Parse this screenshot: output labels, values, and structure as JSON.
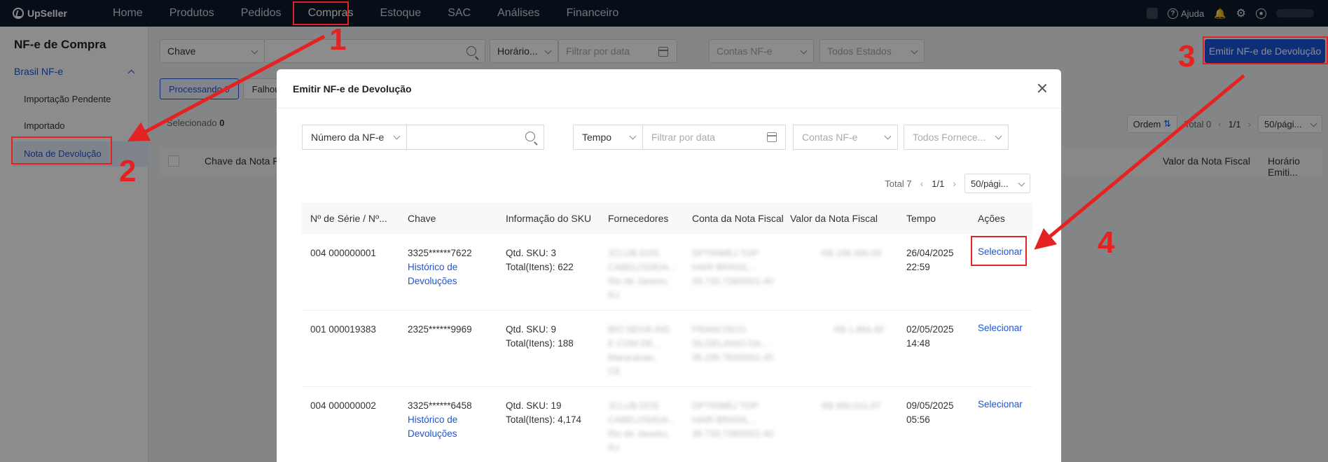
{
  "app": {
    "logo": "UpSeller",
    "nav": [
      "Home",
      "Produtos",
      "Pedidos",
      "Compras",
      "Estoque",
      "SAC",
      "Análises",
      "Financeiro"
    ],
    "active_nav": "Compras",
    "help": "Ajuda"
  },
  "sidebar": {
    "title": "NF-e de Compra",
    "group": "Brasil NF-e",
    "items": [
      "Importação Pendente",
      "Importado",
      "Nota de Devolução"
    ],
    "active": "Nota de Devolução"
  },
  "background": {
    "filters": {
      "key_select": "Chave",
      "time_select": "Horário...",
      "date_placeholder": "Filtrar por data",
      "accounts": "Contas NF-e",
      "states": "Todos Estados"
    },
    "emit_button": "Emitir NF-e de Devolução",
    "tabs": [
      "Processando 0",
      "Falhou"
    ],
    "selected_label": "Selecionado",
    "selected_count": "0",
    "order_button": "Ordem",
    "total": "Total 0",
    "page": "1/1",
    "per_page": "50/pági...",
    "columns": [
      "Chave da Nota Fiscal",
      "Valor da Nota Fiscal",
      "Horário Emiti..."
    ]
  },
  "modal": {
    "title": "Emitir NF-e de Devolução",
    "filters": {
      "nf_select": "Número da NF-e",
      "time_select": "Tempo",
      "date_placeholder": "Filtrar por data",
      "accounts": "Contas NF-e",
      "suppliers": "Todos Fornece..."
    },
    "total": "Total 7",
    "page": "1/1",
    "per_page": "50/pági...",
    "columns": [
      "Nº de Série / Nº...",
      "Chave",
      "Informação do SKU",
      "Fornecedores",
      "Conta da Nota Fiscal",
      "Valor da Nota Fiscal",
      "Tempo",
      "Ações"
    ],
    "rows": [
      {
        "serie": "004 000000001",
        "chave": "3325******7622",
        "history": [
          "Histórico de",
          "Devoluções"
        ],
        "sku_qtd": "Qtd. SKU: 3",
        "sku_total": "Total(Itens): 622",
        "supplier": [
          "JCLUB DOS",
          "CABELOS/EIA...",
          "Rio de Janeiro,",
          "RJ"
        ],
        "account": [
          "DPTRIMEJ TOP",
          "HAIR BRASIL...",
          "39.733.728/0001-40"
        ],
        "value": "R$ 168.490,00",
        "date": "26/04/2025",
        "time": "22:59",
        "action": "Selecionar"
      },
      {
        "serie": "001 000019383",
        "chave": "2325******9969",
        "history": [],
        "sku_qtd": "Qtd. SKU: 9",
        "sku_total": "Total(Itens): 188",
        "supplier": [
          "BIO SEIVA IND",
          "E COM DE...",
          "Maracanau,",
          "CE"
        ],
        "account": [
          "FRANCISCO",
          "SILDELANIO DA...",
          "36.190.783/0001-45"
        ],
        "value": "R$ 1.864,40",
        "date": "02/05/2025",
        "time": "14:48",
        "action": "Selecionar"
      },
      {
        "serie": "004 000000002",
        "chave": "3325******6458",
        "history": [
          "Histórico de",
          "Devoluções"
        ],
        "sku_qtd": "Qtd. SKU: 19",
        "sku_total": "Total(Itens): 4,174",
        "supplier": [
          "JCLUB DOS",
          "CABELOS/EIA...",
          "Rio de Janeiro,",
          "RJ"
        ],
        "account": [
          "DPTRIMEJ TOP",
          "HAIR BRASIL...",
          "39.733.728/0001-40"
        ],
        "value": "R$ 900.011,07",
        "date": "09/05/2025",
        "time": "05:56",
        "action": "Selecionar"
      }
    ]
  },
  "annotations": {
    "labels": [
      "1",
      "2",
      "3",
      "4"
    ],
    "color": "#e52222"
  }
}
